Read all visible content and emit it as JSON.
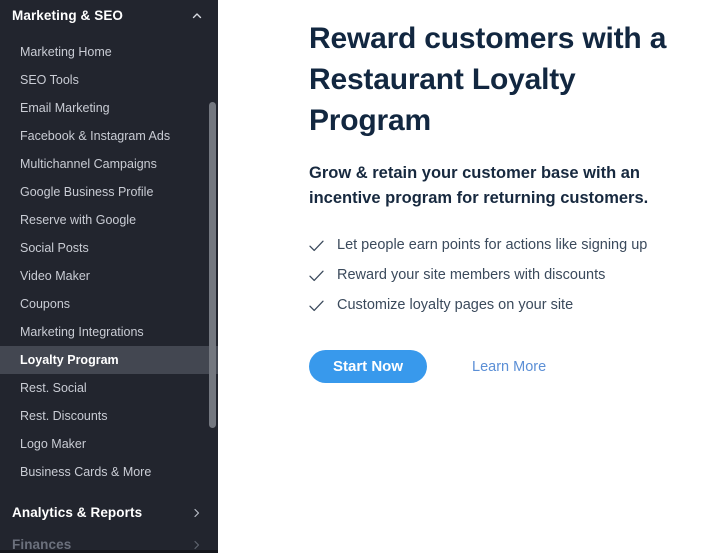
{
  "sidebar": {
    "section": {
      "title": "Marketing & SEO",
      "collapse_icon": "chevron-up-icon"
    },
    "items": [
      {
        "label": "Marketing Home",
        "active": false
      },
      {
        "label": "SEO Tools",
        "active": false
      },
      {
        "label": "Email Marketing",
        "active": false
      },
      {
        "label": "Facebook & Instagram Ads",
        "active": false
      },
      {
        "label": "Multichannel Campaigns",
        "active": false
      },
      {
        "label": "Google Business Profile",
        "active": false
      },
      {
        "label": "Reserve with Google",
        "active": false
      },
      {
        "label": "Social Posts",
        "active": false
      },
      {
        "label": "Video Maker",
        "active": false
      },
      {
        "label": "Coupons",
        "active": false
      },
      {
        "label": "Marketing Integrations",
        "active": false
      },
      {
        "label": "Loyalty Program",
        "active": true
      },
      {
        "label": "Rest. Social",
        "active": false
      },
      {
        "label": "Rest. Discounts",
        "active": false
      },
      {
        "label": "Logo Maker",
        "active": false
      },
      {
        "label": "Business Cards & More",
        "active": false
      }
    ],
    "other_sections": [
      {
        "label": "Analytics & Reports",
        "expand_icon": "chevron-right-icon",
        "dim": false
      },
      {
        "label": "Finances",
        "expand_icon": "chevron-right-icon",
        "dim": true
      }
    ],
    "colors": {
      "background": "#22252e",
      "active_row": "#434751",
      "item_text": "#c9ccd4",
      "header_text": "#ffffff",
      "dim_text": "#6b707c",
      "scrollbar_thumb": "#73777f"
    }
  },
  "main": {
    "headline": "Reward customers with a Restaurant Loyalty Program",
    "subheadline": "Grow & retain your customer base with an incentive program for returning customers.",
    "features": [
      {
        "icon": "check-icon",
        "text": "Let people earn points for actions like signing up"
      },
      {
        "icon": "check-icon",
        "text": "Reward your site members with discounts"
      },
      {
        "icon": "check-icon",
        "text": "Customize loyalty pages on your site"
      }
    ],
    "primary_button": "Start Now",
    "secondary_link": "Learn More",
    "colors": {
      "headline": "#122740",
      "body_text": "#3b4a5c",
      "primary_button_bg": "#3899ec",
      "secondary_link": "#5b8fd6",
      "background": "#ffffff"
    }
  }
}
